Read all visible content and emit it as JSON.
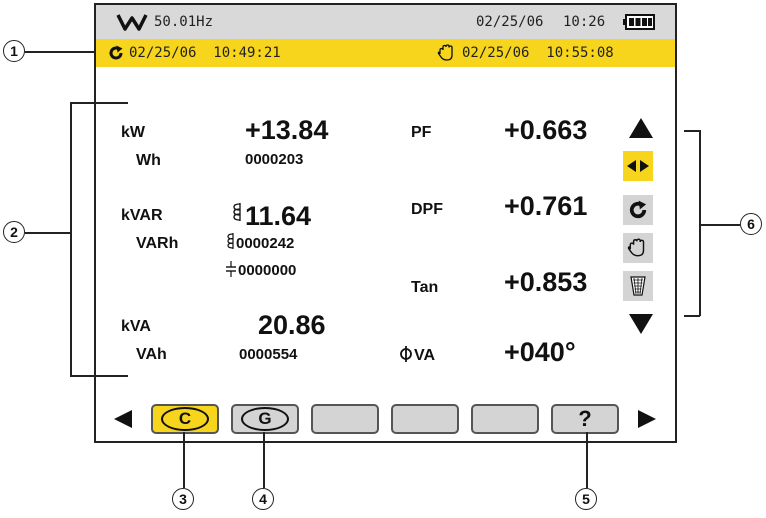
{
  "status": {
    "frequency": "50.01Hz",
    "date": "02/25/06",
    "time": "10:26"
  },
  "timebar": {
    "start_datetime": "02/25/06  10:49:21",
    "end_datetime": "02/25/06  10:55:08"
  },
  "measurements": {
    "kw_label": "kW",
    "kw_value": "+13.84",
    "wh_label": "Wh",
    "wh_value": "0000203",
    "kvar_label": "kVAR",
    "kvar_value": "11.64",
    "varh_label": "VARh",
    "varh_inductive_value": "0000242",
    "varh_capacitive_value": "0000000",
    "kva_label": "kVA",
    "kva_value": "20.86",
    "vah_label": "VAh",
    "vah_value": "0000554",
    "pf_label": "PF",
    "pf_value": "+0.663",
    "dpf_label": "DPF",
    "dpf_value": "+0.761",
    "tan_label": "Tan",
    "tan_value": "+0.853",
    "phi_label": "VA",
    "phi_value": "+040°"
  },
  "function_keys": {
    "c_label": "C",
    "g_label": "G",
    "help_label": "?"
  },
  "callouts": {
    "c1": "1",
    "c2": "2",
    "c3": "3",
    "c4": "4",
    "c5": "5",
    "c6": "6"
  },
  "colors": {
    "highlight": "#f7d51d",
    "status_bar": "#d9d9d9",
    "button_gray": "#d4d4d4"
  },
  "icons": {
    "mode": "power-mode-icon",
    "battery": "battery-icon",
    "start": "start-cycle-icon",
    "stop": "hand-icon",
    "navigation": [
      "triangle-up-icon",
      "left-right-icon",
      "start-cycle-icon",
      "hand-icon",
      "trash-icon",
      "triangle-down-icon"
    ],
    "softkeys": [
      "triangle-left-icon",
      "triangle-right-icon"
    ]
  }
}
